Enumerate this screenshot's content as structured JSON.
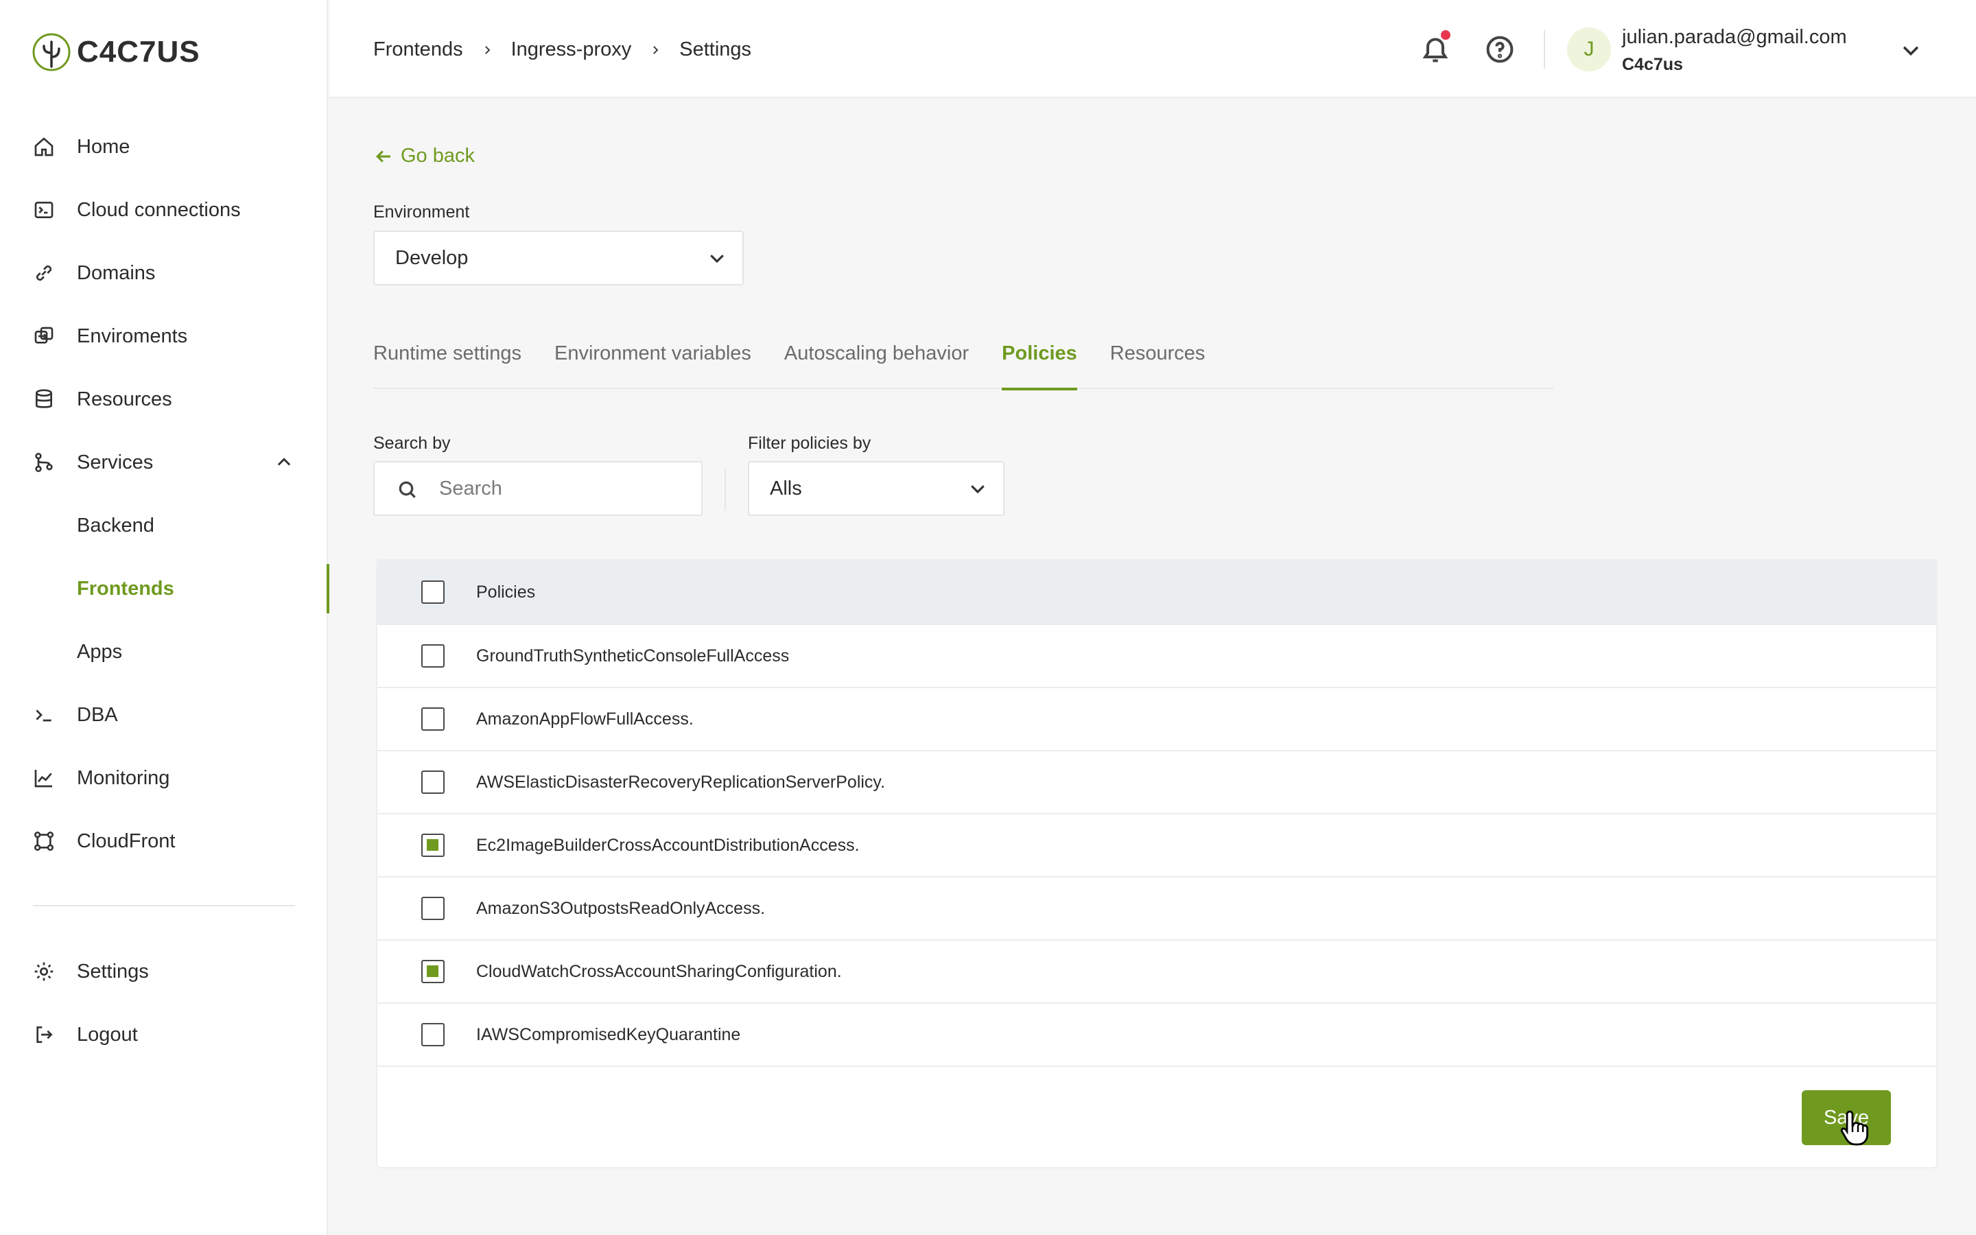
{
  "brand": {
    "name": "C4C7US"
  },
  "sidebar": {
    "items": [
      {
        "label": "Home",
        "icon": "home-icon"
      },
      {
        "label": "Cloud connections",
        "icon": "terminal-box-icon"
      },
      {
        "label": "Domains",
        "icon": "link-icon"
      },
      {
        "label": "Enviroments",
        "icon": "swap-icon"
      },
      {
        "label": "Resources",
        "icon": "database-icon"
      },
      {
        "label": "Services",
        "icon": "git-branch-icon",
        "expanded": true
      }
    ],
    "sub_items": [
      {
        "label": "Backend"
      },
      {
        "label": "Frontends",
        "active": true
      },
      {
        "label": "Apps"
      }
    ],
    "items_after": [
      {
        "label": "DBA",
        "icon": "prompt-icon"
      },
      {
        "label": "Monitoring",
        "icon": "line-chart-icon"
      },
      {
        "label": "CloudFront",
        "icon": "nodes-icon"
      }
    ],
    "bottom": [
      {
        "label": "Settings",
        "icon": "gear-icon"
      },
      {
        "label": "Logout",
        "icon": "logout-icon"
      }
    ]
  },
  "header": {
    "breadcrumb": [
      "Frontends",
      "Ingress-proxy",
      "Settings"
    ],
    "user": {
      "initial": "J",
      "email": "julian.parada@gmail.com",
      "org": "C4c7us"
    },
    "notifications_unread": true
  },
  "main": {
    "go_back": "Go back",
    "environment": {
      "label": "Environment",
      "value": "Develop"
    },
    "tabs": [
      {
        "label": "Runtime settings"
      },
      {
        "label": "Environment variables"
      },
      {
        "label": "Autoscaling behavior"
      },
      {
        "label": "Policies",
        "active": true
      },
      {
        "label": "Resources"
      }
    ],
    "search": {
      "label": "Search by",
      "placeholder": "Search",
      "value": ""
    },
    "filter": {
      "label": "Filter policies by",
      "value": "Alls"
    },
    "table": {
      "header": "Policies",
      "header_checked": false,
      "rows": [
        {
          "name": "GroundTruthSyntheticConsoleFullAccess",
          "checked": false
        },
        {
          "name": "AmazonAppFlowFullAccess.",
          "checked": false
        },
        {
          "name": "AWSElasticDisasterRecoveryReplicationServerPolicy.",
          "checked": false
        },
        {
          "name": "Ec2ImageBuilderCrossAccountDistributionAccess.",
          "checked": true
        },
        {
          "name": "AmazonS3OutpostsReadOnlyAccess.",
          "checked": false
        },
        {
          "name": "CloudWatchCrossAccountSharingConfiguration.",
          "checked": true
        },
        {
          "name": "IAWSCompromisedKeyQuarantine",
          "checked": false
        }
      ]
    },
    "save_label": "Save"
  },
  "colors": {
    "accent": "#6f9a1f",
    "notification": "#e8364e",
    "header_row": "#ebeef0"
  }
}
